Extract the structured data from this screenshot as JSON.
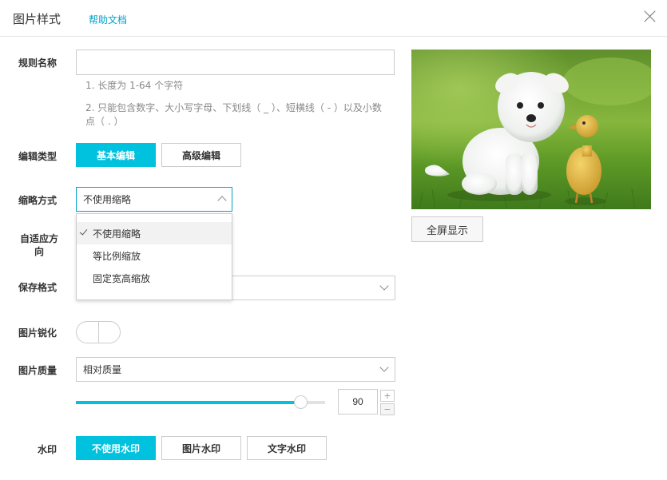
{
  "header": {
    "title": "图片样式",
    "help_link": "帮助文档",
    "close_icon": "close-icon"
  },
  "form": {
    "rule_name": {
      "label": "规则名称",
      "value": "",
      "hints": [
        "1. 长度为 1-64 个字符",
        "2. 只能包含数字、大小写字母、下划线（ _ ）、短横线（ - ）以及小数点（ . ）"
      ]
    },
    "edit_type": {
      "label": "编辑类型",
      "options": [
        "基本编辑",
        "高级编辑"
      ],
      "selected": "基本编辑"
    },
    "thumbnail": {
      "label": "缩略方式",
      "value": "不使用缩略",
      "options": [
        "不使用缩略",
        "等比例缩放",
        "固定宽高缩放"
      ],
      "selected_index": 0
    },
    "adaptive": {
      "label": "自适应方向"
    },
    "save_format": {
      "label": "保存格式",
      "value": ""
    },
    "sharpen": {
      "label": "图片锐化",
      "enabled": false
    },
    "quality": {
      "label": "图片质量",
      "value": "相对质量",
      "slider_value": 90,
      "slider_max": 100,
      "number": "90",
      "increment": "+",
      "decrement": "−"
    },
    "watermark": {
      "label": "水印",
      "options": [
        "不使用水印",
        "图片水印",
        "文字水印"
      ],
      "selected": "不使用水印"
    }
  },
  "preview": {
    "fullscreen_label": "全屏显示"
  },
  "colors": {
    "accent": "#00c1de",
    "link": "#00a2ca"
  }
}
